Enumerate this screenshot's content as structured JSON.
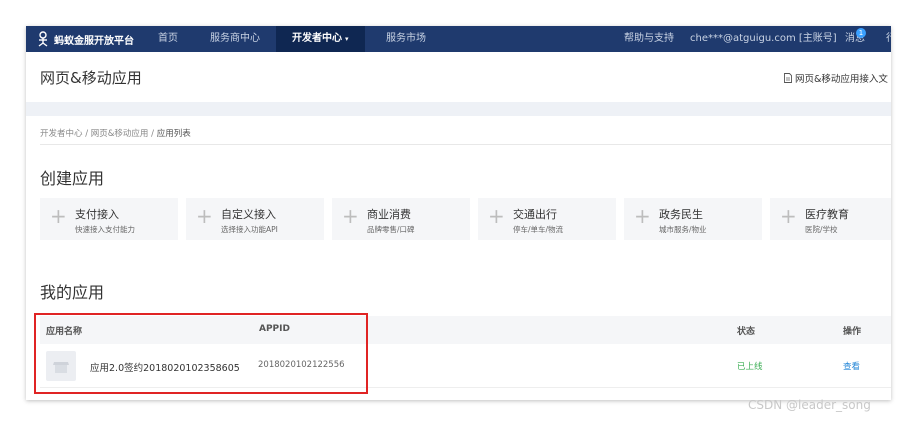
{
  "nav": {
    "logo_text": "蚂蚁金服开放平台",
    "items": [
      "首页",
      "服务商中心",
      "开发者中心",
      "服务市场"
    ],
    "caret": "▾",
    "help": "帮助与支持",
    "account": "che***@atguigu.com [主账号]",
    "messages": "消息",
    "message_count": "1",
    "overflow": "行"
  },
  "header": {
    "title": "网页&移动应用",
    "doc_link": "网页&移动应用接入文"
  },
  "breadcrumb": {
    "items": [
      "开发者中心",
      "网页&移动应用",
      "应用列表"
    ],
    "separator": "/"
  },
  "create": {
    "title": "创建应用",
    "cards": [
      {
        "title": "支付接入",
        "desc": "快速接入支付能力"
      },
      {
        "title": "自定义接入",
        "desc": "选择接入功能API"
      },
      {
        "title": "商业消费",
        "desc": "品牌零售/口碑"
      },
      {
        "title": "交通出行",
        "desc": "停车/单车/物流"
      },
      {
        "title": "政务民生",
        "desc": "城市服务/物业"
      },
      {
        "title": "医疗教育",
        "desc": "医院/学校"
      }
    ]
  },
  "my_apps": {
    "title": "我的应用",
    "columns": [
      "应用名称",
      "APPID",
      "状态",
      "操作"
    ],
    "rows": [
      {
        "name": "应用2.0签约20180201023586​05",
        "appid": "2018020102122556",
        "status": "已上线",
        "action": "查看"
      }
    ]
  },
  "watermark": "CSDN @leader_song",
  "colors": {
    "nav_bg": "#1f3a6e",
    "nav_active": "#0f2752",
    "status_online": "#3cae55",
    "link": "#1e83d6",
    "highlight": "#e02424"
  }
}
